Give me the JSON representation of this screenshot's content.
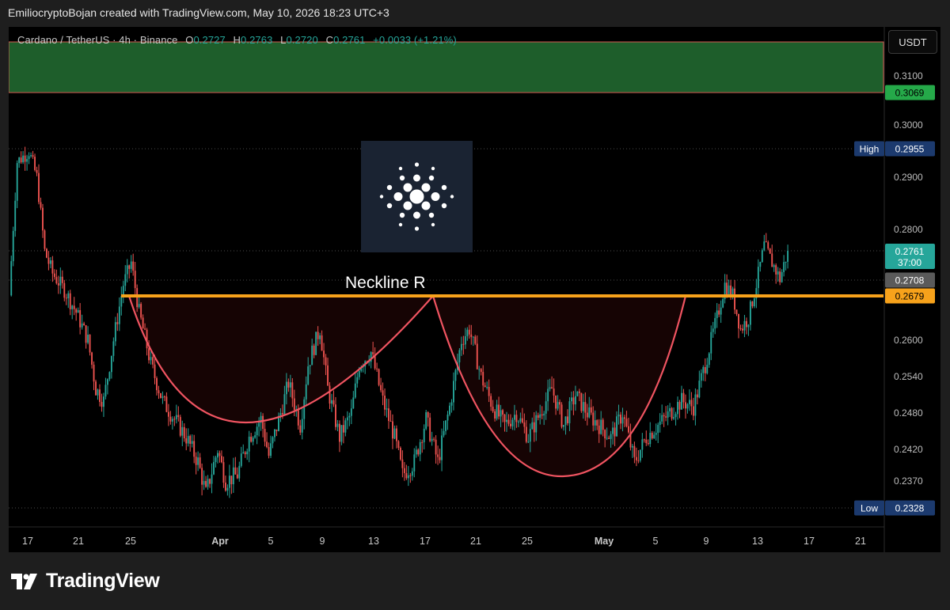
{
  "header": {
    "attribution": "EmiliocryptoBojan created with TradingView.com, May 10, 2026 18:23 UTC+3"
  },
  "legend": {
    "symbol": "Cardano / TetherUS · 4h · Binance",
    "o_label": "O",
    "o_value": "0.2727",
    "h_label": "H",
    "h_value": "0.2763",
    "l_label": "L",
    "l_value": "0.2720",
    "c_label": "C",
    "c_value": "0.2761",
    "change": "+0.0033 (+1.21%)"
  },
  "currency_button": "USDT",
  "footer": {
    "brand": "TradingView"
  },
  "colors": {
    "up": "#26a69a",
    "down": "#ef5350",
    "neckline": "#f7a21b",
    "cup": "#f05461",
    "zone": "#1e5e2b",
    "high_badge": "#1c3a6e"
  },
  "chart_data": {
    "type": "candlestick",
    "pair": "ADA/USDT",
    "interval": "4h",
    "x_ticks": [
      "17",
      "21",
      "25",
      "Apr",
      "5",
      "9",
      "13",
      "17",
      "21",
      "25",
      "May",
      "5",
      "9",
      "13",
      "17",
      "21"
    ],
    "y_ticks": [
      "0.3100",
      "0.3000",
      "0.2900",
      "0.2800",
      "0.2600",
      "0.2540",
      "0.2480",
      "0.2420",
      "0.2370"
    ],
    "price_labels": [
      {
        "value": "0.3069",
        "color": "#25a949"
      },
      {
        "label": "High",
        "value": "0.2955",
        "color": "#1c3a6e"
      },
      {
        "value": "0.2761",
        "sub": "37:00",
        "color": "#26a69a"
      },
      {
        "value": "0.2708",
        "color": "#5a5a5a"
      },
      {
        "value": "0.2679",
        "color": "#f7a21b"
      },
      {
        "label": "Low",
        "value": "0.2328",
        "color": "#1c3a6e"
      }
    ],
    "annotation": "Neckline R",
    "neckline": 0.2679,
    "resistance_zone": [
      0.3069,
      0.315
    ],
    "period_high": 0.2955,
    "period_low": 0.2328,
    "last_price": 0.2761,
    "previous_close": 0.2708,
    "range_start": "Mar 15",
    "range_end": "May 10",
    "path": [
      [
        0,
        0.268
      ],
      [
        4,
        0.293
      ],
      [
        10,
        0.295
      ],
      [
        14,
        0.29
      ],
      [
        18,
        0.276
      ],
      [
        22,
        0.272
      ],
      [
        28,
        0.269
      ],
      [
        34,
        0.265
      ],
      [
        40,
        0.26
      ],
      [
        44,
        0.252
      ],
      [
        48,
        0.25
      ],
      [
        54,
        0.262
      ],
      [
        58,
        0.27
      ],
      [
        62,
        0.274
      ],
      [
        66,
        0.265
      ],
      [
        72,
        0.256
      ],
      [
        78,
        0.25
      ],
      [
        84,
        0.247
      ],
      [
        90,
        0.244
      ],
      [
        96,
        0.24
      ],
      [
        100,
        0.235
      ],
      [
        106,
        0.242
      ],
      [
        110,
        0.237
      ],
      [
        116,
        0.238
      ],
      [
        122,
        0.244
      ],
      [
        128,
        0.247
      ],
      [
        132,
        0.241
      ],
      [
        138,
        0.248
      ],
      [
        142,
        0.253
      ],
      [
        148,
        0.246
      ],
      [
        152,
        0.256
      ],
      [
        158,
        0.262
      ],
      [
        162,
        0.252
      ],
      [
        168,
        0.244
      ],
      [
        174,
        0.248
      ],
      [
        178,
        0.256
      ],
      [
        184,
        0.258
      ],
      [
        190,
        0.25
      ],
      [
        196,
        0.244
      ],
      [
        200,
        0.238
      ],
      [
        206,
        0.24
      ],
      [
        212,
        0.247
      ],
      [
        218,
        0.24
      ],
      [
        224,
        0.249
      ],
      [
        230,
        0.26
      ],
      [
        234,
        0.262
      ],
      [
        240,
        0.254
      ],
      [
        246,
        0.249
      ],
      [
        252,
        0.246
      ],
      [
        258,
        0.248
      ],
      [
        264,
        0.244
      ],
      [
        270,
        0.248
      ],
      [
        276,
        0.252
      ],
      [
        282,
        0.246
      ],
      [
        288,
        0.251
      ],
      [
        294,
        0.248
      ],
      [
        300,
        0.246
      ],
      [
        306,
        0.244
      ],
      [
        312,
        0.248
      ],
      [
        318,
        0.24
      ],
      [
        324,
        0.244
      ],
      [
        330,
        0.246
      ],
      [
        336,
        0.248
      ],
      [
        342,
        0.25
      ],
      [
        348,
        0.249
      ],
      [
        354,
        0.256
      ],
      [
        360,
        0.264
      ],
      [
        364,
        0.27
      ],
      [
        368,
        0.268
      ],
      [
        372,
        0.262
      ],
      [
        376,
        0.264
      ],
      [
        380,
        0.27
      ],
      [
        384,
        0.277
      ],
      [
        388,
        0.274
      ],
      [
        392,
        0.271
      ],
      [
        396,
        0.2761
      ]
    ],
    "total_candles": 396,
    "right_padding_candles": 49
  }
}
